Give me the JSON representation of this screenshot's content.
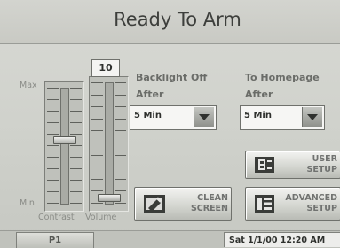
{
  "header": {
    "title": "Ready To Arm"
  },
  "sliders": {
    "max_label": "Max",
    "min_label": "Min",
    "contrast": {
      "label": "Contrast",
      "level": 0.55
    },
    "volume": {
      "label": "Volume",
      "value": "10",
      "level": 0.05
    }
  },
  "backlight": {
    "label_line1": "Backlight Off",
    "label_line2": "After",
    "selected": "5 Min"
  },
  "homepage": {
    "label_line1": "To Homepage",
    "label_line2": "After",
    "selected": "5 Min"
  },
  "buttons": {
    "user_setup": {
      "line1": "USER",
      "line2": "SETUP"
    },
    "clean_screen": {
      "line1": "CLEAN",
      "line2": "SCREEN"
    },
    "advanced_setup": {
      "line1": "ADVANCED",
      "line2": "SETUP"
    }
  },
  "footer": {
    "tab": "P1",
    "status": "Sat 1/1/00 12:20 AM"
  },
  "icons": [
    "dropdown-arrow-icon",
    "user-setup-icon",
    "clean-screen-icon",
    "advanced-setup-icon"
  ]
}
